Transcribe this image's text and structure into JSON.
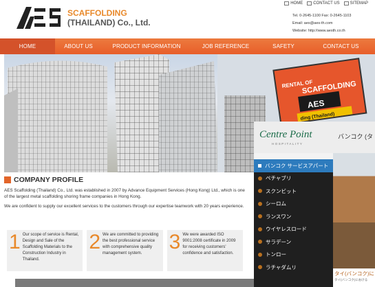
{
  "header": {
    "company_line1": "SCAFFOLDING",
    "company_line2": "(THAILAND) Co., Ltd.",
    "logo_text": "AES",
    "toplinks": [
      "HOME",
      "CONTACT US",
      "SITEMAP"
    ],
    "contact": {
      "tel": "Tel. 0-2645-1100 Fax: 0-2645-1103",
      "email": "Email: aes@aes-th.com",
      "website": "Website: http://www.aesth.co.th"
    }
  },
  "nav": [
    "HOME",
    "ABOUT US",
    "PRODUCT INFORMATION",
    "JOB REFERENCE",
    "SAFETY",
    "CONTACT US"
  ],
  "hero": {
    "billboard_line1": "RENTAL OF",
    "billboard_line2": "SCAFFOLDING",
    "billboard_line3": "ding (Thailand)"
  },
  "profile": {
    "title": "COMPANY PROFILE",
    "p1": "AES Scaffolding (Thailand) Co., Ltd. was established in 2007 by Advance Equipment Services (Hong Kong) Ltd., which is one of the largest metal scaffolding shoring frame companies in Hong Kong.",
    "p2": "We are confident to supply our excellent services to the customers through our expertise teamwork with 20 years experience.",
    "boxes": [
      {
        "num": "1",
        "text": "Our scope of service is Rental, Design and Sale of the Scaffolding Materials to the Construction Industry in Thailand."
      },
      {
        "num": "2",
        "text": "We are committed to providing the best professional service with comprehensive quality management system."
      },
      {
        "num": "3",
        "text": "We were awarded ISO 9001:2008 certificate in 2009 for receiving customers' confidence and satisfaction."
      }
    ]
  },
  "popup": {
    "logo": "Centre Point",
    "logo_sub": "HOSPITALITY",
    "header_jp": "バンコク (タ",
    "menu": [
      "バンコク サービスアパート",
      "ペチャブリ",
      "スクンビット",
      "シーロム",
      "ランスワン",
      "ウイヤレスロード",
      "サラデーン",
      "トンロー",
      "ラチャダムリ"
    ],
    "caption": "タイ(バンコク)に",
    "caption_small": "タイ(バンコク)における"
  },
  "colors": {
    "accent": "#e8892b",
    "nav": "#e85e2a",
    "popup_menu": "#1f1f1f",
    "popup_highlight": "#2d7bbd"
  }
}
